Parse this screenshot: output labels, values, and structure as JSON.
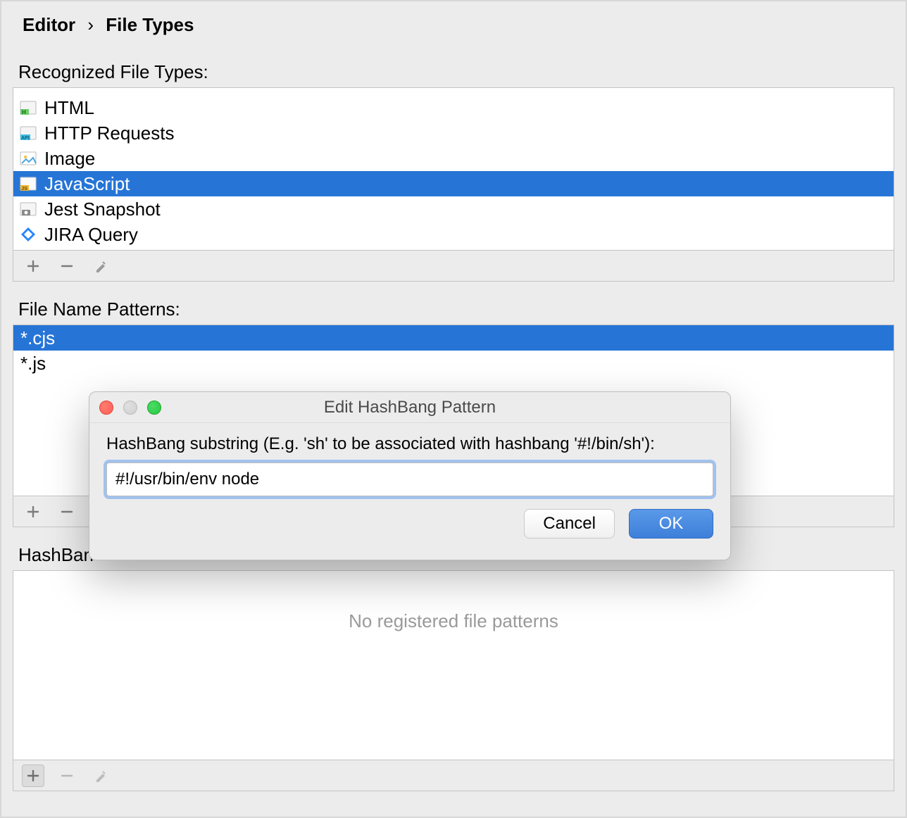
{
  "breadcrumb": {
    "editor": "Editor",
    "sep": "›",
    "filetypes": "File Types"
  },
  "sections": {
    "recognized_label": "Recognized File Types:",
    "patterns_label": "File Name Patterns:",
    "hashbang_label_visible": "HashBan",
    "hashbang_empty": "No registered file patterns"
  },
  "filetypes": {
    "items": [
      {
        "label": "HTML",
        "icon": "html-file-icon"
      },
      {
        "label": "HTTP Requests",
        "icon": "api-file-icon"
      },
      {
        "label": "Image",
        "icon": "image-file-icon"
      },
      {
        "label": "JavaScript",
        "icon": "js-file-icon",
        "selected": true
      },
      {
        "label": "Jest Snapshot",
        "icon": "snapshot-file-icon"
      },
      {
        "label": "JIRA Query",
        "icon": "jira-file-icon"
      }
    ]
  },
  "patterns": {
    "items": [
      {
        "label": "*.cjs",
        "selected": true
      },
      {
        "label": "*.js"
      }
    ]
  },
  "dialog": {
    "title": "Edit HashBang Pattern",
    "label": "HashBang substring (E.g. 'sh' to be associated with hashbang '#!/bin/sh'):",
    "value": "#!/usr/bin/env node",
    "cancel": "Cancel",
    "ok": "OK"
  }
}
